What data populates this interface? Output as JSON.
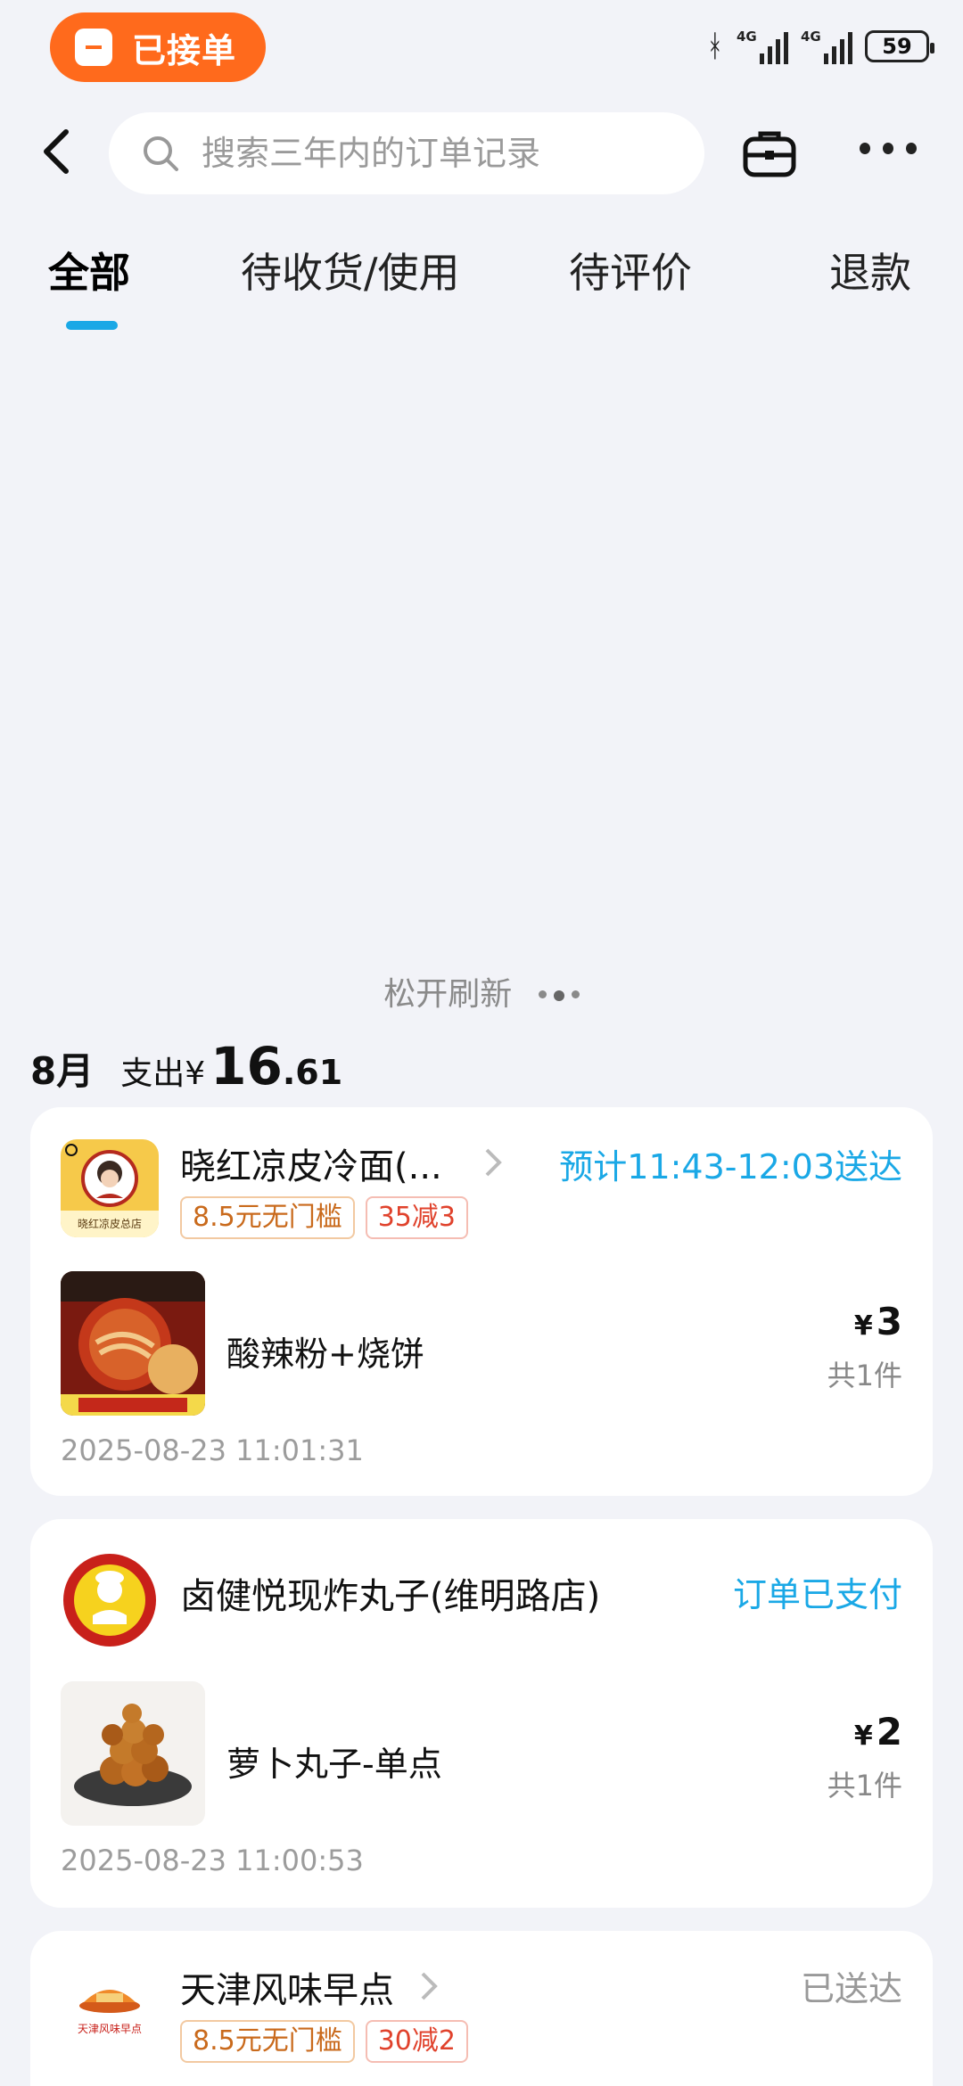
{
  "status_bar": {
    "pill_label": "已接单",
    "network1": "4G",
    "network2": "4G",
    "battery": "59"
  },
  "top_bar": {
    "search_placeholder": "搜索三年内的订单记录"
  },
  "tabs": [
    {
      "label": "全部",
      "active": true
    },
    {
      "label": "待收货/使用",
      "active": false
    },
    {
      "label": "待评价",
      "active": false
    },
    {
      "label": "退款",
      "active": false
    }
  ],
  "refresh_label": "松开刷新",
  "summary": {
    "month": "8月",
    "spend_label": "支出¥",
    "spend_int": "16",
    "spend_dec": ".61"
  },
  "orders": [
    {
      "store": "晓红凉皮冷面(...",
      "status": "预计11:43-12:03送达",
      "tags": [
        "8.5元无门槛",
        "35减3"
      ],
      "item": "酸辣粉+烧饼",
      "currency": "¥",
      "price": "3",
      "qty": "共1件",
      "time": "2025-08-23 11:01:31",
      "logo_text": "晓红凉皮总店"
    },
    {
      "store": "卤健悦现炸丸子(维明路店)",
      "status": "订单已支付",
      "item": "萝卜丸子-单点",
      "currency": "¥",
      "price": "2",
      "qty": "共1件",
      "time": "2025-08-23 11:00:53"
    },
    {
      "store": "天津风味早点",
      "status": "已送达",
      "tags": [
        "8.5元无门槛",
        "30减2"
      ],
      "logo_text": "天津风味早点"
    }
  ],
  "colors": {
    "accent": "#1aa8e6",
    "pill": "#ff6a1c",
    "background": "#f2f3f8"
  }
}
